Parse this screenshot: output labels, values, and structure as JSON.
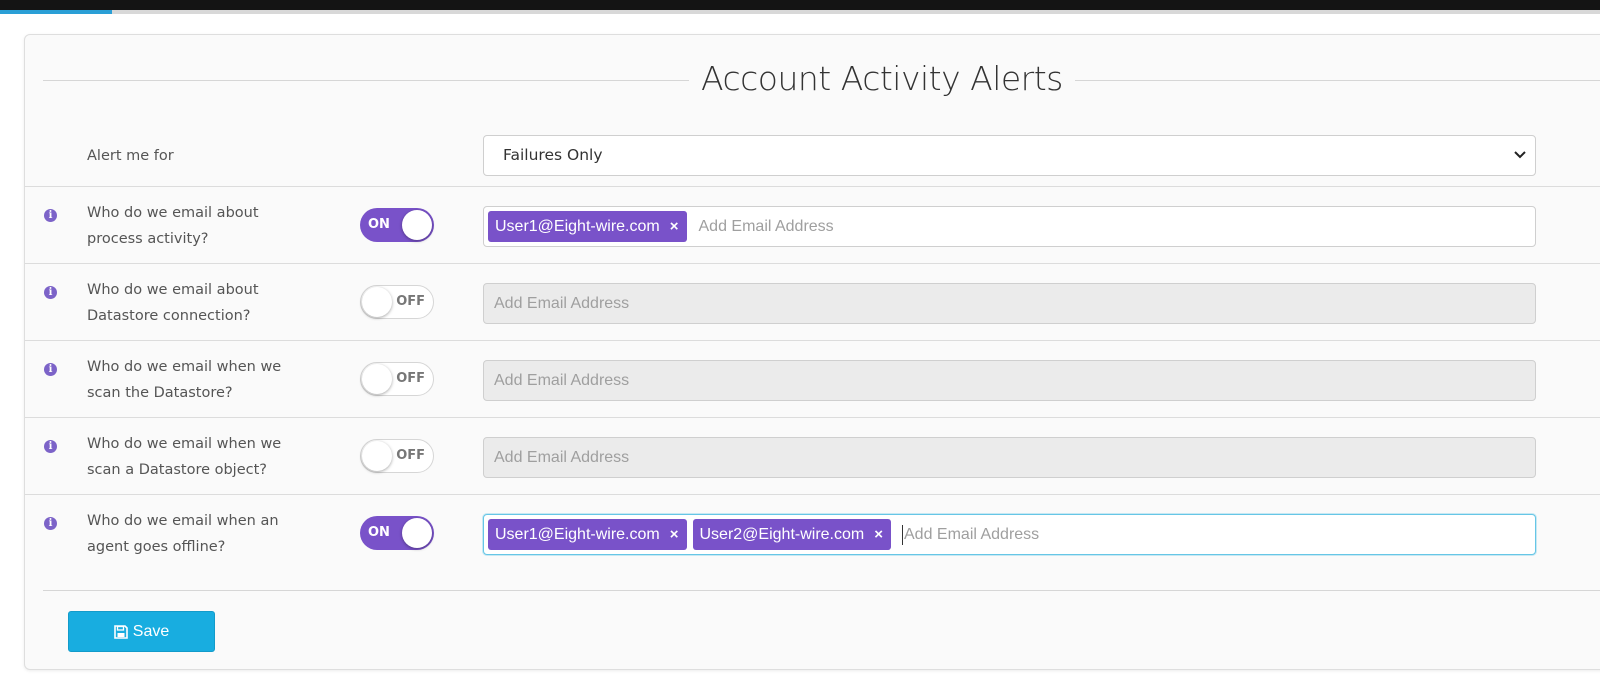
{
  "title": "Account Activity Alerts",
  "colors": {
    "accent": "#7952c9",
    "save": "#18ade0"
  },
  "alert_for": {
    "label": "Alert me for",
    "selected": "Failures Only"
  },
  "rows": [
    {
      "label_line1": "Who do we email about",
      "label_line2": "process activity?",
      "toggle": "ON",
      "emails": [
        "User1@Eight-wire.com"
      ],
      "placeholder": "Add Email Address"
    },
    {
      "label_line1": "Who do we email about",
      "label_line2": "Datastore connection?",
      "toggle": "OFF",
      "emails": [],
      "placeholder": "Add Email Address"
    },
    {
      "label_line1": "Who do we email when we",
      "label_line2": "scan the Datastore?",
      "toggle": "OFF",
      "emails": [],
      "placeholder": "Add Email Address"
    },
    {
      "label_line1": "Who do we email when we",
      "label_line2": "scan a Datastore object?",
      "toggle": "OFF",
      "emails": [],
      "placeholder": "Add Email Address"
    },
    {
      "label_line1": "Who do we email when an",
      "label_line2": "agent goes offline?",
      "toggle": "ON",
      "emails": [
        "User1@Eight-wire.com",
        "User2@Eight-wire.com"
      ],
      "placeholder": "Add Email Address"
    }
  ],
  "tag_remove": "×",
  "save_label": "Save"
}
